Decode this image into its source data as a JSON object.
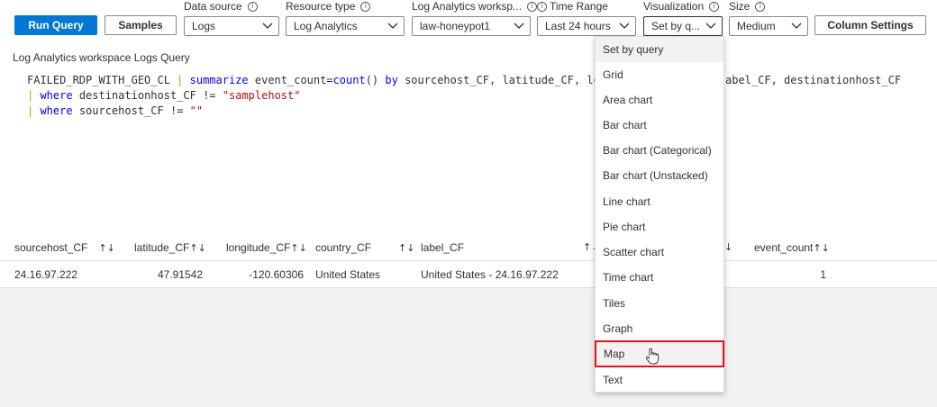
{
  "toolbar": {
    "run_query": "Run Query",
    "samples": "Samples",
    "column_settings": "Column Settings"
  },
  "fields": {
    "data_source": {
      "label": "Data source",
      "value": "Logs"
    },
    "resource_type": {
      "label": "Resource type",
      "value": "Log Analytics"
    },
    "workspace": {
      "label": "Log Analytics worksp...",
      "value": "law-honeypot1"
    },
    "time_range": {
      "label": "Time Range",
      "value": "Last 24 hours"
    },
    "visualization": {
      "label": "Visualization",
      "value": "Set by q..."
    },
    "size": {
      "label": "Size",
      "value": "Medium"
    }
  },
  "query": {
    "title": "Log Analytics workspace Logs Query",
    "line1_a": "FAILED_RDP_WITH_GEO_CL ",
    "line1_pipe": "|",
    "line1_kw": " summarize",
    "line1_b": " event_count=",
    "line1_fn": "count",
    "line1_c": "() ",
    "line1_by": "by",
    "line1_d": " sourcehost_CF, latitude_CF, longitu",
    "line1_tail": "abel_CF, destinationhost_CF",
    "line2_pipe": "|",
    "line2_kw": " where",
    "line2_a": " destinationhost_CF != ",
    "line2_str": "\"samplehost\"",
    "line3_pipe": "|",
    "line3_kw": " where",
    "line3_a": " sourcehost_CF != ",
    "line3_str": "\"\""
  },
  "table": {
    "headers": [
      "sourcehost_CF",
      "latitude_CF",
      "longitude_CF",
      "country_CF",
      "label_CF",
      "event_count"
    ],
    "rows": [
      [
        "24.16.97.222",
        "47.91542",
        "-120.60306",
        "United States",
        "United States - 24.16.97.222",
        "1"
      ]
    ]
  },
  "visualization_menu": {
    "items": [
      "Set by query",
      "Grid",
      "Area chart",
      "Bar chart",
      "Bar chart (Categorical)",
      "Bar chart (Unstacked)",
      "Line chart",
      "Pie chart",
      "Scatter chart",
      "Time chart",
      "Tiles",
      "Graph",
      "Map",
      "Text"
    ],
    "selected": "Set by query",
    "highlighted": "Map",
    "highlight_color": "#e81123"
  },
  "colors": {
    "primary": "#0078d4",
    "lower_area": "#f3f2f1"
  }
}
